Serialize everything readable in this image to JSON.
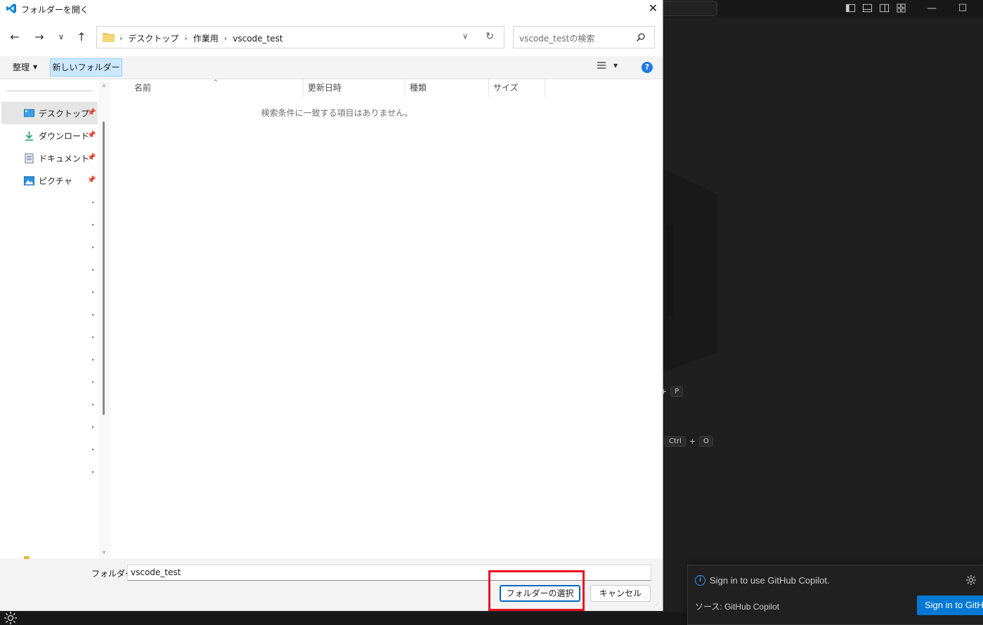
{
  "dialog": {
    "title": "フォルダーを開く",
    "close_glyph": "✕",
    "breadcrumbs": [
      "デスクトップ",
      "作業用",
      "vscode_test"
    ],
    "search_placeholder": "vscode_testの検索",
    "toolbar": {
      "organize": "整理",
      "new_folder": "新しいフォルダー"
    },
    "nav_items": [
      {
        "label": "デスクトップ",
        "icon": "desktop-icon",
        "selected": true
      },
      {
        "label": "ダウンロード",
        "icon": "download-icon",
        "selected": false
      },
      {
        "label": "ドキュメント",
        "icon": "documents-icon",
        "selected": false
      },
      {
        "label": "ピクチャ",
        "icon": "pictures-icon",
        "selected": false
      }
    ],
    "columns": [
      "名前",
      "更新日時",
      "種類",
      "サイズ"
    ],
    "empty_message": "検索条件に一致する項目はありません。",
    "folder_label": "フォルダー:",
    "folder_value": "vscode_test",
    "select_button": "フォルダーの選択",
    "cancel_button": "キャンセル"
  },
  "vscode": {
    "shortcut_1": {
      "keys": [
        "+",
        "P"
      ]
    },
    "shortcut_2": {
      "keys": [
        "Ctrl",
        "+",
        "O"
      ]
    },
    "notification": {
      "message": "Sign in to use GitHub Copilot.",
      "source": "ソース: GitHub Copilot",
      "button": "Sign in to GitHub"
    }
  },
  "colors": {
    "accent": "#0067c0",
    "highlight": "#e81123",
    "vscode_blue": "#0078d4",
    "new_folder_bg": "#cce8ff"
  }
}
